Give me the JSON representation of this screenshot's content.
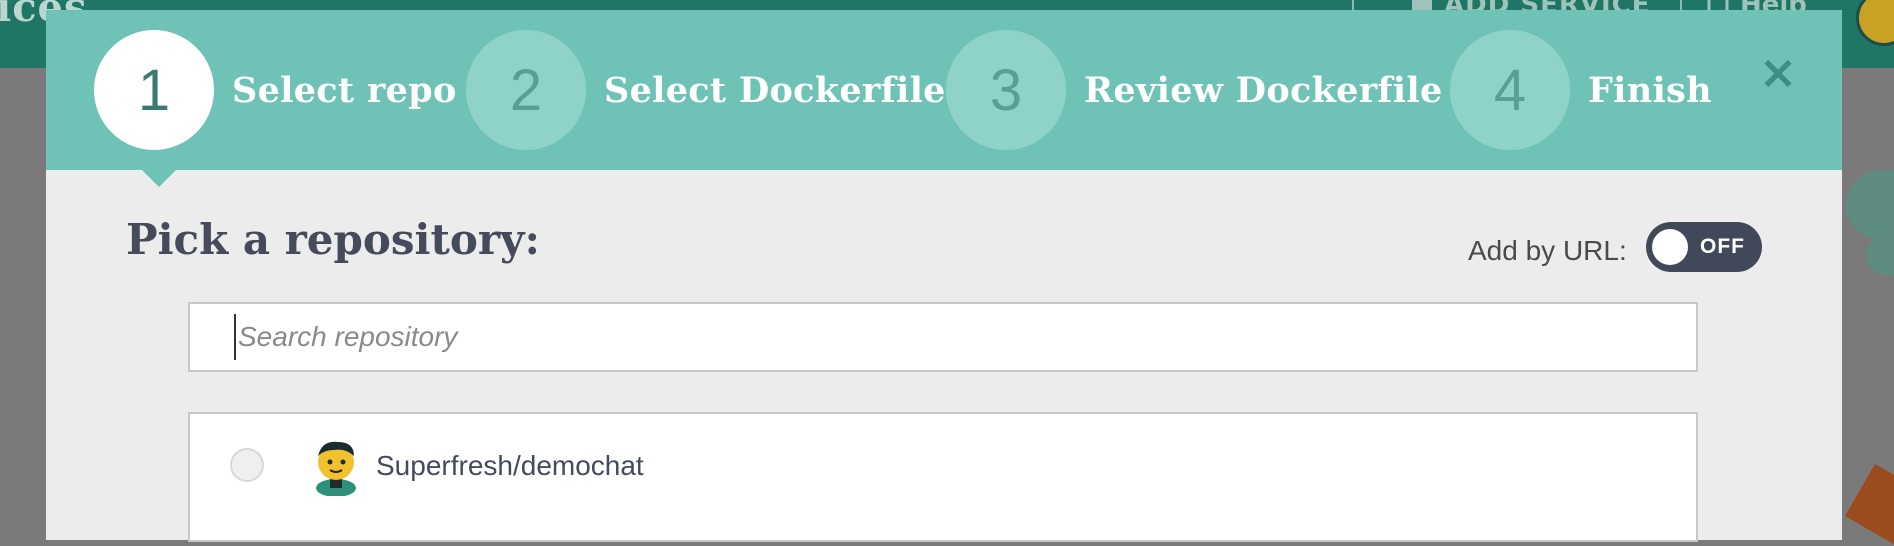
{
  "background": {
    "title_fragment": "ices",
    "add_service": "ADD SERVICE",
    "help": "Help"
  },
  "wizard": {
    "steps": [
      {
        "number": "1",
        "label": "Select repo",
        "active": true
      },
      {
        "number": "2",
        "label": "Select Dockerfile",
        "active": false
      },
      {
        "number": "3",
        "label": "Review Dockerfile",
        "active": false
      },
      {
        "number": "4",
        "label": "Finish",
        "active": false
      }
    ],
    "close_icon": "×"
  },
  "main": {
    "heading": "Pick a repository:",
    "add_by_url_label": "Add by URL:",
    "toggle_state": "OFF",
    "search_placeholder": "Search repository",
    "search_value": ""
  },
  "repos": [
    {
      "name": "Superfresh/demochat",
      "selected": false
    }
  ],
  "colors": {
    "header_teal": "#6fc3b6",
    "step_inactive": "#8fd3c8",
    "toggle_bg": "#404859",
    "text_dark": "#454b5a"
  }
}
